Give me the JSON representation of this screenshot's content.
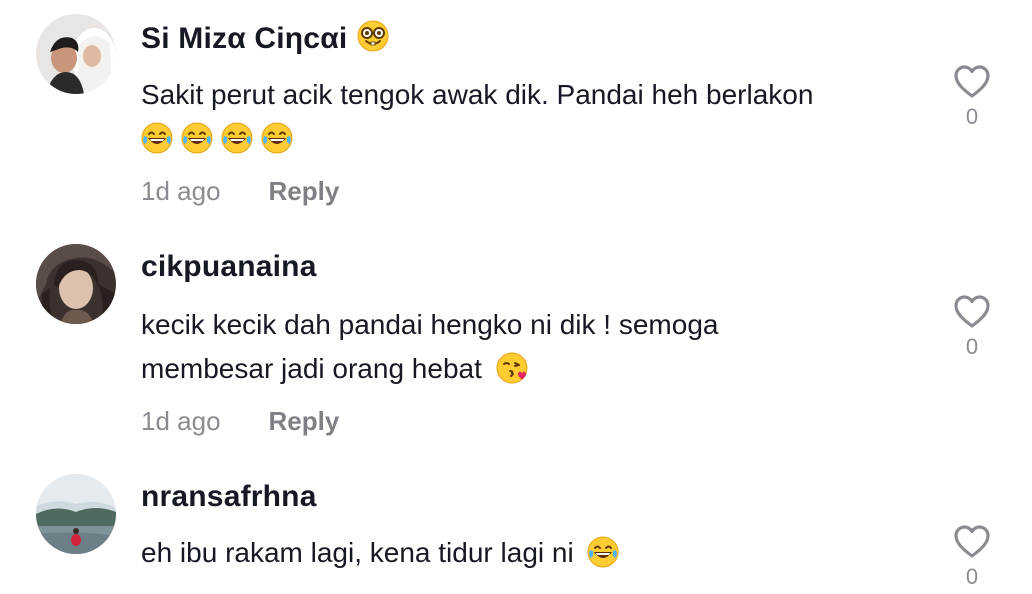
{
  "comments": [
    {
      "username": "Si Mizα Ciηcαi",
      "username_emoji": "nerd-face",
      "text_line1": "Sakit perut acik tengok awak dik. Pandai heh berlakon",
      "text_emojis": [
        "face-with-tears-of-joy",
        "face-with-tears-of-joy",
        "face-with-tears-of-joy",
        "face-with-tears-of-joy"
      ],
      "time": "1d ago",
      "reply_label": "Reply",
      "likes": "0"
    },
    {
      "username": "cikpuanaina",
      "text_line1": "kecik kecik dah pandai hengko ni dik ! semoga",
      "text_line2": "membesar jadi orang hebat",
      "text_emojis": [
        "face-blowing-a-kiss"
      ],
      "time": "1d ago",
      "reply_label": "Reply",
      "likes": "0"
    },
    {
      "username": "nransafrhna",
      "text_line1": "eh ibu rakam lagi, kena tidur lagi ni",
      "text_emojis": [
        "face-with-tears-of-joy"
      ],
      "likes": "0"
    }
  ],
  "colors": {
    "primary_text": "#161823",
    "secondary_text": "rgba(22,24,35,0.5)",
    "background": "#ffffff"
  }
}
